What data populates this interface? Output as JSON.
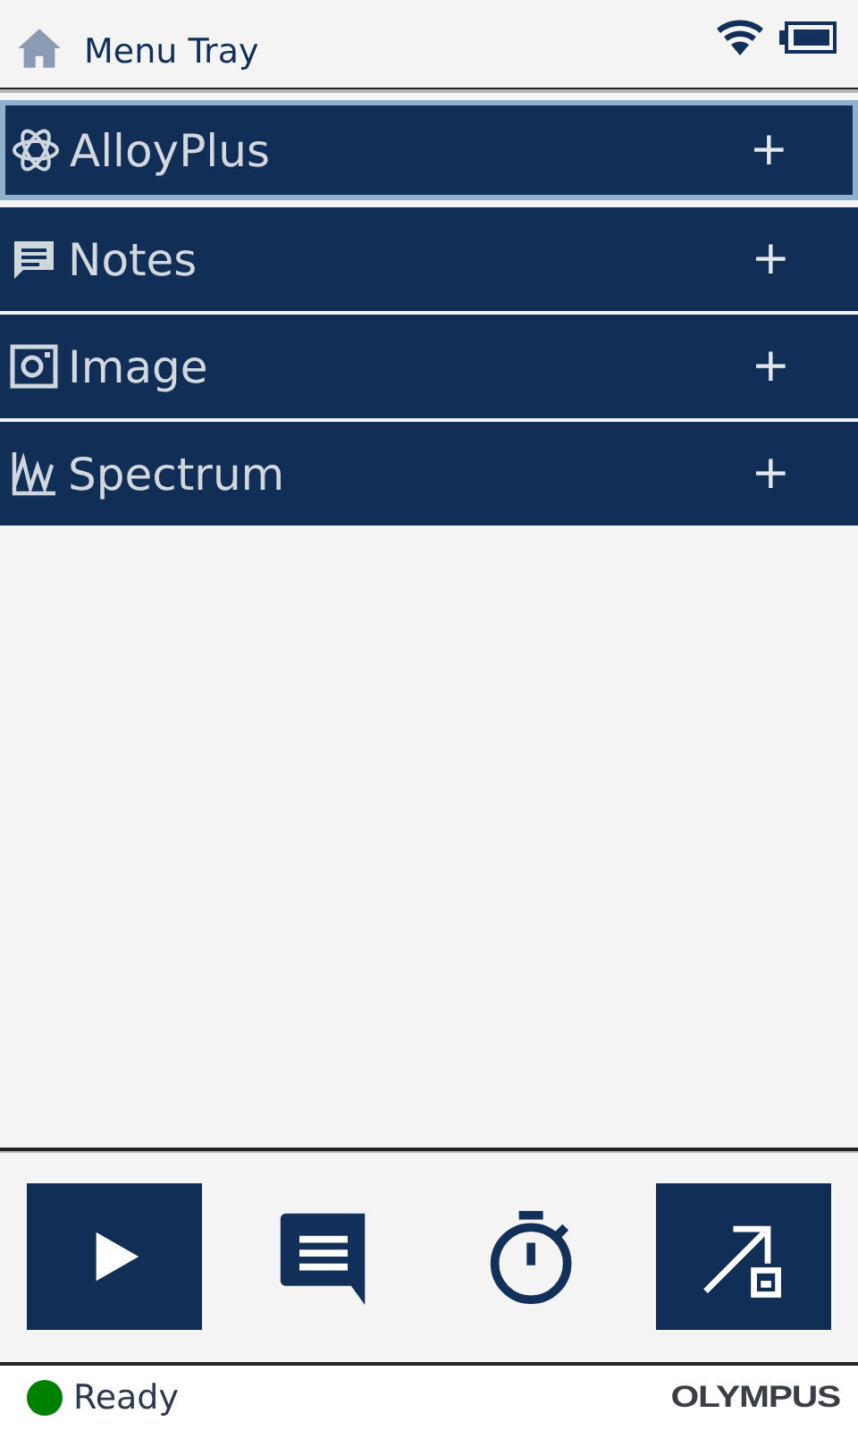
{
  "header": {
    "title": "Menu Tray"
  },
  "menu_items": [
    {
      "kind": "atom",
      "label": "AlloyPlus",
      "expander": "+",
      "selected": true
    },
    {
      "kind": "notes",
      "label": "Notes",
      "expander": "+",
      "selected": false
    },
    {
      "kind": "image",
      "label": "Image",
      "expander": "+",
      "selected": false
    },
    {
      "kind": "spectrum",
      "label": "Spectrum",
      "expander": "+",
      "selected": false
    }
  ],
  "toolbar": [
    {
      "kind": "play",
      "filled": true
    },
    {
      "kind": "notes",
      "filled": false
    },
    {
      "kind": "timer",
      "filled": false
    },
    {
      "kind": "export",
      "filled": true
    }
  ],
  "status_bar": {
    "status": "Ready",
    "color": "#008000",
    "brand": "OLYMPUS"
  }
}
